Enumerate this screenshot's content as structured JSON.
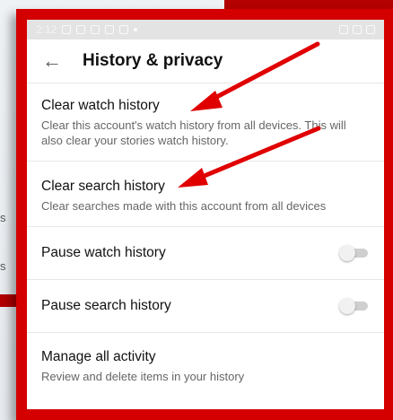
{
  "background_screen": {
    "fragments": [
      "s",
      "s"
    ]
  },
  "status_bar": {
    "time": "2:12"
  },
  "app_bar": {
    "back_icon": "arrow-left-icon",
    "title": "History & privacy"
  },
  "settings": {
    "clear_watch": {
      "title": "Clear watch history",
      "subtitle": "Clear this account's watch history from all devices. This will also clear your stories watch history."
    },
    "clear_search": {
      "title": "Clear search history",
      "subtitle": "Clear searches made with this account from all devices"
    },
    "pause_watch": {
      "title": "Pause watch history",
      "enabled": false
    },
    "pause_search": {
      "title": "Pause search history",
      "enabled": false
    },
    "manage_activity": {
      "title": "Manage all activity",
      "subtitle": "Review and delete items in your history"
    }
  },
  "annotations": {
    "arrow_color": "#e00000",
    "frame_color": "#d40000"
  }
}
